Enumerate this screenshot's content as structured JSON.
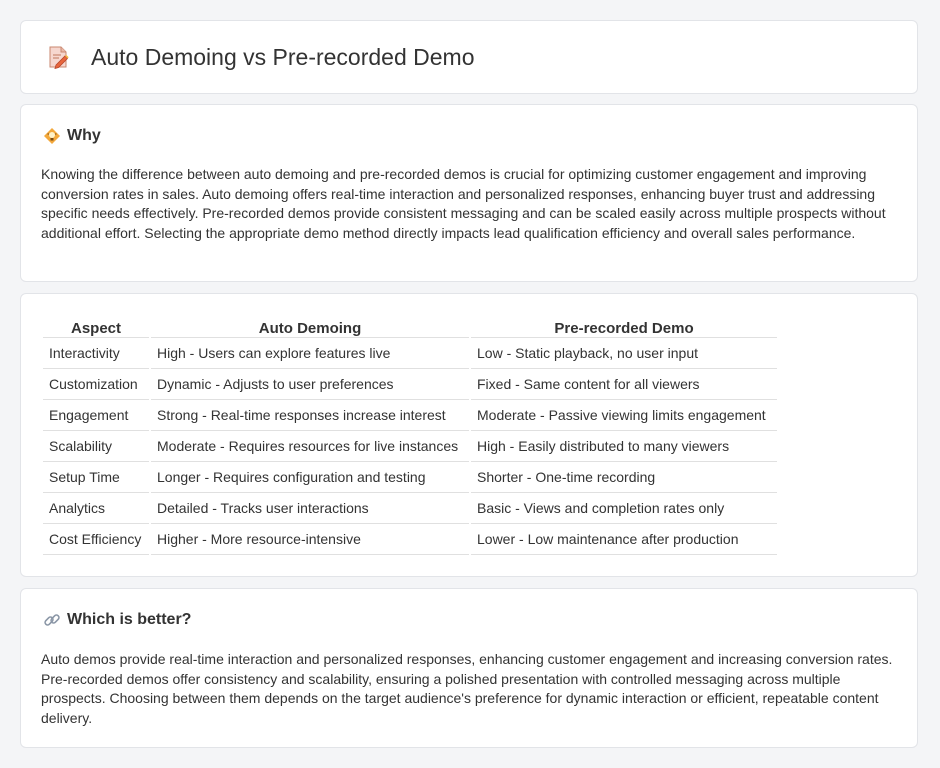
{
  "header": {
    "title": "Auto Demoing vs Pre-recorded Demo",
    "icon": "document-pencil-icon"
  },
  "why": {
    "icon": "lightbulb-icon",
    "heading": "Why",
    "text": "Knowing the difference between auto demoing and pre-recorded demos is crucial for optimizing customer engagement and improving conversion rates in sales. Auto demoing offers real-time interaction and personalized responses, enhancing buyer trust and addressing specific needs effectively. Pre-recorded demos provide consistent messaging and can be scaled easily across multiple prospects without additional effort. Selecting the appropriate demo method directly impacts lead qualification efficiency and overall sales performance."
  },
  "comparison": {
    "headers": [
      "Aspect",
      "Auto Demoing",
      "Pre-recorded Demo"
    ],
    "rows": [
      [
        "Interactivity",
        "High - Users can explore features live",
        "Low - Static playback, no user input"
      ],
      [
        "Customization",
        "Dynamic - Adjusts to user preferences",
        "Fixed - Same content for all viewers"
      ],
      [
        "Engagement",
        "Strong - Real-time responses increase interest",
        "Moderate - Passive viewing limits engagement"
      ],
      [
        "Scalability",
        "Moderate - Requires resources for live instances",
        "High - Easily distributed to many viewers"
      ],
      [
        "Setup Time",
        "Longer - Requires configuration and testing",
        "Shorter - One-time recording"
      ],
      [
        "Analytics",
        "Detailed - Tracks user interactions",
        "Basic - Views and completion rates only"
      ],
      [
        "Cost Efficiency",
        "Higher - More resource-intensive",
        "Lower - Low maintenance after production"
      ]
    ]
  },
  "better": {
    "icon": "link-icon",
    "heading": "Which is better?",
    "text": "Auto demos provide real-time interaction and personalized responses, enhancing customer engagement and increasing conversion rates. Pre-recorded demos offer consistency and scalability, ensuring a polished presentation with controlled messaging across multiple prospects. Choosing between them depends on the target audience's preference for dynamic interaction or efficient, repeatable content delivery."
  },
  "colors": {
    "background": "#f4f5f7",
    "card": "#ffffff",
    "text": "#333333",
    "icon_accent": "#f0a030"
  }
}
